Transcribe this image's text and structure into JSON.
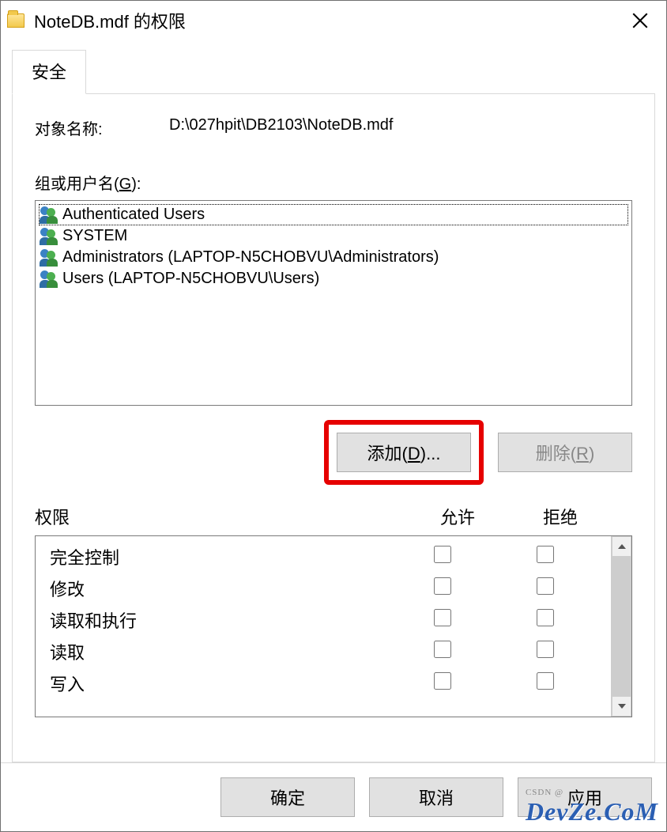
{
  "window": {
    "title": "NoteDB.mdf 的权限"
  },
  "tabs": {
    "security": "安全"
  },
  "object": {
    "label": "对象名称:",
    "path": "D:\\027hpit\\DB2103\\NoteDB.mdf"
  },
  "groups": {
    "label_prefix": "组或用户名(",
    "label_hotkey": "G",
    "label_suffix": "):",
    "items": [
      "Authenticated Users",
      "SYSTEM",
      "Administrators (LAPTOP-N5CHOBVU\\Administrators)",
      "Users (LAPTOP-N5CHOBVU\\Users)"
    ]
  },
  "buttons": {
    "add_prefix": "添加(",
    "add_hotkey": "D",
    "add_suffix": ")...",
    "remove_prefix": "删除(",
    "remove_hotkey": "R",
    "remove_suffix": ")"
  },
  "perm": {
    "header": "权限",
    "allow": "允许",
    "deny": "拒绝",
    "rows": [
      "完全控制",
      "修改",
      "读取和执行",
      "读取",
      "写入"
    ]
  },
  "footer": {
    "ok": "确定",
    "cancel": "取消",
    "apply": "应用"
  },
  "watermark": {
    "text": "DevZe.CoM",
    "sub": "CSDN @"
  }
}
